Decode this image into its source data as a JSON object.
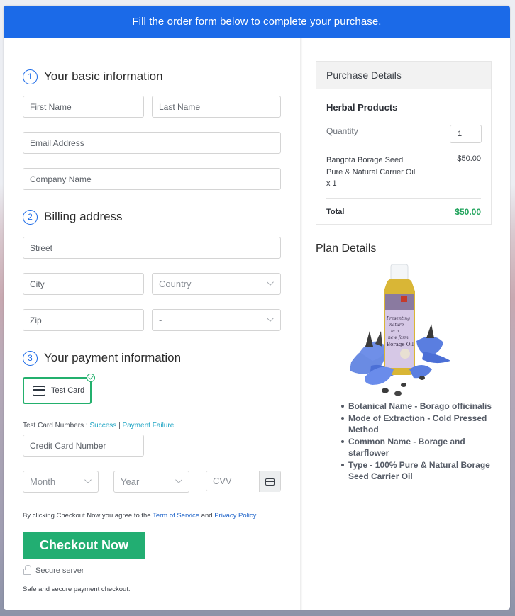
{
  "banner": {
    "text": "Fill the order form below to complete your purchase."
  },
  "form": {
    "section1": {
      "number": "1",
      "title": "Your basic information"
    },
    "first_name": {
      "placeholder": "First Name"
    },
    "last_name": {
      "placeholder": "Last Name"
    },
    "email": {
      "placeholder": "Email Address"
    },
    "company": {
      "placeholder": "Company Name"
    },
    "section2": {
      "number": "2",
      "title": "Billing address"
    },
    "street": {
      "placeholder": "Street"
    },
    "city": {
      "placeholder": "City"
    },
    "country": {
      "selected": "Country"
    },
    "zip": {
      "placeholder": "Zip"
    },
    "state": {
      "selected": "-"
    },
    "section3": {
      "number": "3",
      "title": "Your payment information"
    },
    "payment_method": {
      "label": "Test Card",
      "selected": true
    },
    "test_numbers": {
      "label": "Test Card Numbers :",
      "success": "Success",
      "separator": "|",
      "failure": "Payment Failure"
    },
    "card_number": {
      "placeholder": "Credit Card Number"
    },
    "month": {
      "selected": "Month"
    },
    "year": {
      "selected": "Year"
    },
    "cvv": {
      "placeholder": "CVV"
    },
    "agreement": {
      "prefix": "By clicking Checkout Now you agree to the",
      "terms": "Term of Service",
      "and": "and",
      "privacy": "Privacy Policy"
    },
    "checkout_label": "Checkout Now",
    "secure_label": "Secure server",
    "safe_note": "Safe and secure payment checkout."
  },
  "purchase": {
    "header": "Purchase Details",
    "category": "Herbal Products",
    "quantity_label": "Quantity",
    "quantity_value": "1",
    "item_line1": "Bangota Borage Seed",
    "item_line2": "Pure & Natural Carrier Oil",
    "item_line3": "x 1",
    "item_price": "$50.00",
    "total_label": "Total",
    "total_value": "$50.00"
  },
  "plan": {
    "title": "Plan Details",
    "image_alt": "Borage Oil bottle with blue borage flowers",
    "bottle_label": [
      "Presenting",
      "nature",
      "in a",
      "new form",
      "Borage Oil"
    ],
    "features": [
      "Botanical Name - Borago officinalis",
      "Mode of Extraction - Cold Pressed Method",
      "Common Name - Borage and starflower",
      "Type - 100% Pure & Natural Borage Seed Carrier Oil"
    ]
  },
  "colors": {
    "primary": "#1b6ae8",
    "success": "#22ae72",
    "total_green": "#22a45d",
    "link_teal": "#1fa5c4",
    "link_blue": "#1f64c9"
  }
}
